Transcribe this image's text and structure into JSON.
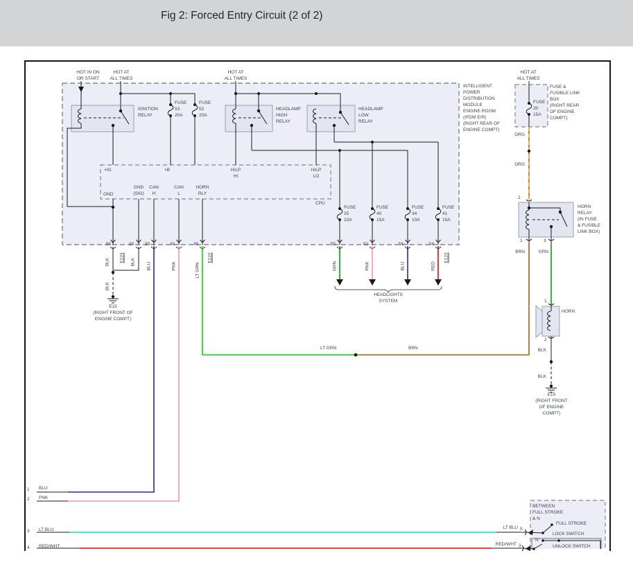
{
  "header": {
    "title": "Fig 2: Forced Entry Circuit (2 of 2)"
  },
  "colors": {
    "blu": "#2222cc",
    "pnk": "#ff8fb4",
    "lt_grn": "#00dd00",
    "grn": "#00a000",
    "red": "#e60000",
    "lt_blu": "#00e6e6",
    "red_wht": "#dd0000",
    "brn": "#8a6a14",
    "org": "#ff9500",
    "box_fill": "#ecedf7",
    "relay_fill": "#e3e5f1"
  },
  "power": {
    "hot_in_on": "HOT IN ON\nOR START",
    "hot_at": "HOT AT\nALL TIMES"
  },
  "ipdm": {
    "label": "INTELLIGENT\nPOWER\nDISTRIBUTION\nMODULE\nENGINE ROOM\n(IPDM E/R)\n(RIGHT REAR OF\nENGINE COMPT)",
    "ignition_relay": "IGNITION\nRELAY",
    "headlamp_high": "HEADLAMP\nHIGH\nRELAY",
    "headlamp_low": "HEADLAMP\nLOW\nRELAY",
    "cpu": {
      "name": "CPU",
      "ig": "+IG",
      "b": "+B",
      "hlp_hi": "H/LP\nHI",
      "hlp_lo": "H/LP\nLO",
      "gnd": "GND",
      "gnd_sig": "GND\n(SIG)",
      "can_h": "CAN\nH",
      "can_l": "CAN\nL",
      "horn_rly": "HORN\nRLY"
    },
    "fuses": {
      "f53": "FUSE\n53\n20A",
      "f52": "FUSE\n52\n20A",
      "f35": "FUSE\n35\n10A",
      "f40": "FUSE\n40\n15A",
      "f34": "FUSE\n34\n10A",
      "f41": "FUSE\n41\n15A"
    },
    "pins": {
      "p59": "59",
      "p38": "38",
      "p39": "39",
      "p40": "40",
      "p45": "45",
      "p55": "55",
      "p52": "52",
      "p56": "56",
      "p54": "54"
    },
    "connectors": {
      "e124": "E124",
      "e122": "E122",
      "e123": "E123"
    }
  },
  "wire_labels": {
    "blk": "BLK",
    "blu": "BLU",
    "pnk": "PNK",
    "lt_grn": "LT GRN",
    "grn": "GRN",
    "red": "RED",
    "brn": "BRN",
    "org": "ORG",
    "lt_blu": "LT BLU",
    "red_wht": "RED/WHT"
  },
  "grounds": {
    "e15_left": "E15\n(RIGHT FRONT OF\nENGINE COMPT)",
    "e15_right": "E15\n(RIGHT FRONT\nOF ENGINE\nCOMPT)"
  },
  "right": {
    "fuse_link_box": "FUSE &\nFUSIBLE LINK\nBOX\n(RIGHT REAR\nOF ENGINE\nCOMPT)",
    "fuse30": "FUSE\n30\n15A",
    "horn_relay": "HORN\nRELAY\n(IN FUSE\n& FUSIBLE\nLINK BOX)",
    "horn": "HORN",
    "pin2": "2",
    "pin1": "1",
    "pin3": "3",
    "horn_pin1": "1",
    "horn_pin2": "2"
  },
  "headlights": {
    "label": "HEADLIGHTS\nSYSTEM"
  },
  "bottom": {
    "n1": "1",
    "n2": "2",
    "n3": "3",
    "n4": "4",
    "pin5": "5",
    "pin3": "3",
    "lock": {
      "note": "BETWEEN\nFULL STROKE\n& N",
      "full_stroke": "FULL STROKE",
      "lock_switch": "LOCK SWITCH",
      "n": "N",
      "unlock_switch": "UNLOCK SWITCH"
    }
  }
}
